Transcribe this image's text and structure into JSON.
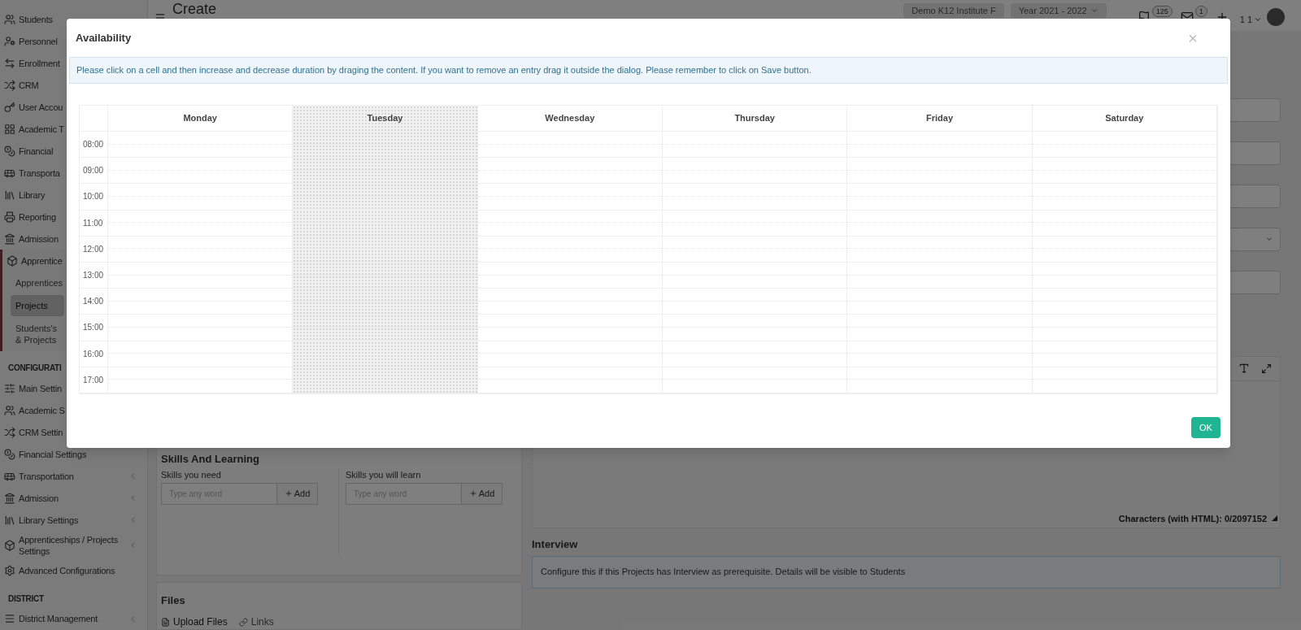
{
  "topbar": {
    "title": "Create",
    "institute": "Demo K12 Institute F",
    "year": "Year 2021 - 2022",
    "badges": [
      "125",
      "1"
    ],
    "user": "1 1"
  },
  "sidebar": {
    "items": [
      {
        "kind": "item",
        "label": "Students"
      },
      {
        "kind": "item",
        "label": "Personnel"
      },
      {
        "kind": "item",
        "label": "Enrollment"
      },
      {
        "kind": "item",
        "label": "CRM"
      },
      {
        "kind": "item",
        "label": "User Accou"
      },
      {
        "kind": "item",
        "label": "Academic T"
      },
      {
        "kind": "item",
        "label": "Financial"
      },
      {
        "kind": "item",
        "label": "Transporta"
      },
      {
        "kind": "item",
        "label": "Library"
      },
      {
        "kind": "item",
        "label": "Reporting"
      },
      {
        "kind": "item",
        "label": "Admission"
      },
      {
        "kind": "item",
        "label": "Apprentice",
        "expanded": true,
        "children": [
          {
            "label": "Apprentices",
            "selected": false
          },
          {
            "label": "Projects",
            "selected": true
          },
          {
            "label": "Students's & Projects",
            "selected": false
          }
        ]
      },
      {
        "kind": "header",
        "label": "CONFIGURATI"
      },
      {
        "kind": "item",
        "label": "Main Settin"
      },
      {
        "kind": "item",
        "label": "Academic S"
      },
      {
        "kind": "item",
        "label": "CRM Settin"
      },
      {
        "kind": "item",
        "label": "Financial Settings"
      },
      {
        "kind": "item",
        "label": "Transportation",
        "expandable": true
      },
      {
        "kind": "item",
        "label": "Admission",
        "expandable": true
      },
      {
        "kind": "item",
        "label": "Library Settings",
        "expandable": true
      },
      {
        "kind": "item",
        "label": "Apprenticeships / Projects Settings",
        "expandable": true
      },
      {
        "kind": "item",
        "label": "Advanced Configurations",
        "expandable": false
      },
      {
        "kind": "header",
        "label": "DISTRICT"
      },
      {
        "kind": "item",
        "label": "District Management",
        "expandable": true
      }
    ]
  },
  "fields": [
    {
      "kind": "input"
    },
    {
      "kind": "input"
    },
    {
      "kind": "input"
    },
    {
      "kind": "select"
    },
    {
      "kind": "input"
    }
  ],
  "skills": {
    "title": "Skills And Learning",
    "groups": [
      {
        "label": "Skills you need",
        "placeholder": "Type any word",
        "button": "Add"
      },
      {
        "label": "Skills you will learn",
        "placeholder": "Type any word",
        "button": "Add"
      }
    ]
  },
  "files": {
    "title": "Files",
    "links": [
      "Upload Files",
      "Links"
    ]
  },
  "editor": {
    "counter": "Characters (with HTML): 0/2097152"
  },
  "interview": {
    "title": "Interview",
    "info": "Configure this if this Projects has Interview as prerequisite. Details will be visible to Students"
  },
  "dialog": {
    "title": "Availability",
    "close": "×",
    "info": "Please click on a cell and then increase and decrease duration by draging the content. If you want to remove an entry drag it outside the dialog. Please remember to click on Save button.",
    "days": [
      {
        "label": "Monday",
        "today": false
      },
      {
        "label": "Tuesday",
        "today": true
      },
      {
        "label": "Wednesday",
        "today": false
      },
      {
        "label": "Thursday",
        "today": false
      },
      {
        "label": "Friday",
        "today": false
      },
      {
        "label": "Saturday",
        "today": false
      }
    ],
    "times": [
      "08:00",
      "09:00",
      "10:00",
      "11:00",
      "12:00",
      "13:00",
      "14:00",
      "15:00",
      "16:00",
      "17:00"
    ],
    "ok": "OK"
  }
}
